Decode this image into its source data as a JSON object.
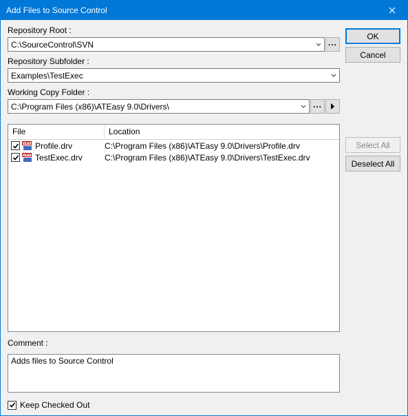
{
  "title": "Add Files to Source Control",
  "buttons": {
    "ok": "OK",
    "cancel": "Cancel",
    "select_all": "Select All",
    "deselect_all": "Deselect All"
  },
  "repo_root": {
    "label": "Repository Root :",
    "value": "C:\\SourceControl\\SVN"
  },
  "repo_subfolder": {
    "label": "Repository Subfolder :",
    "value": "Examples\\TestExec"
  },
  "working_copy": {
    "label": "Working Copy Folder :",
    "value": "C:\\Program Files (x86)\\ATEasy 9.0\\Drivers\\"
  },
  "file_list": {
    "headers": {
      "file": "File",
      "location": "Location"
    },
    "rows": [
      {
        "checked": true,
        "name": "Profile.drv",
        "location": "C:\\Program Files (x86)\\ATEasy 9.0\\Drivers\\Profile.drv"
      },
      {
        "checked": true,
        "name": "TestExec.drv",
        "location": "C:\\Program Files (x86)\\ATEasy 9.0\\Drivers\\TestExec.drv"
      }
    ]
  },
  "comment": {
    "label": "Comment :",
    "value": "Adds files to Source Control"
  },
  "keep_checked_out": {
    "checked": true,
    "label": "Keep Checked Out"
  }
}
